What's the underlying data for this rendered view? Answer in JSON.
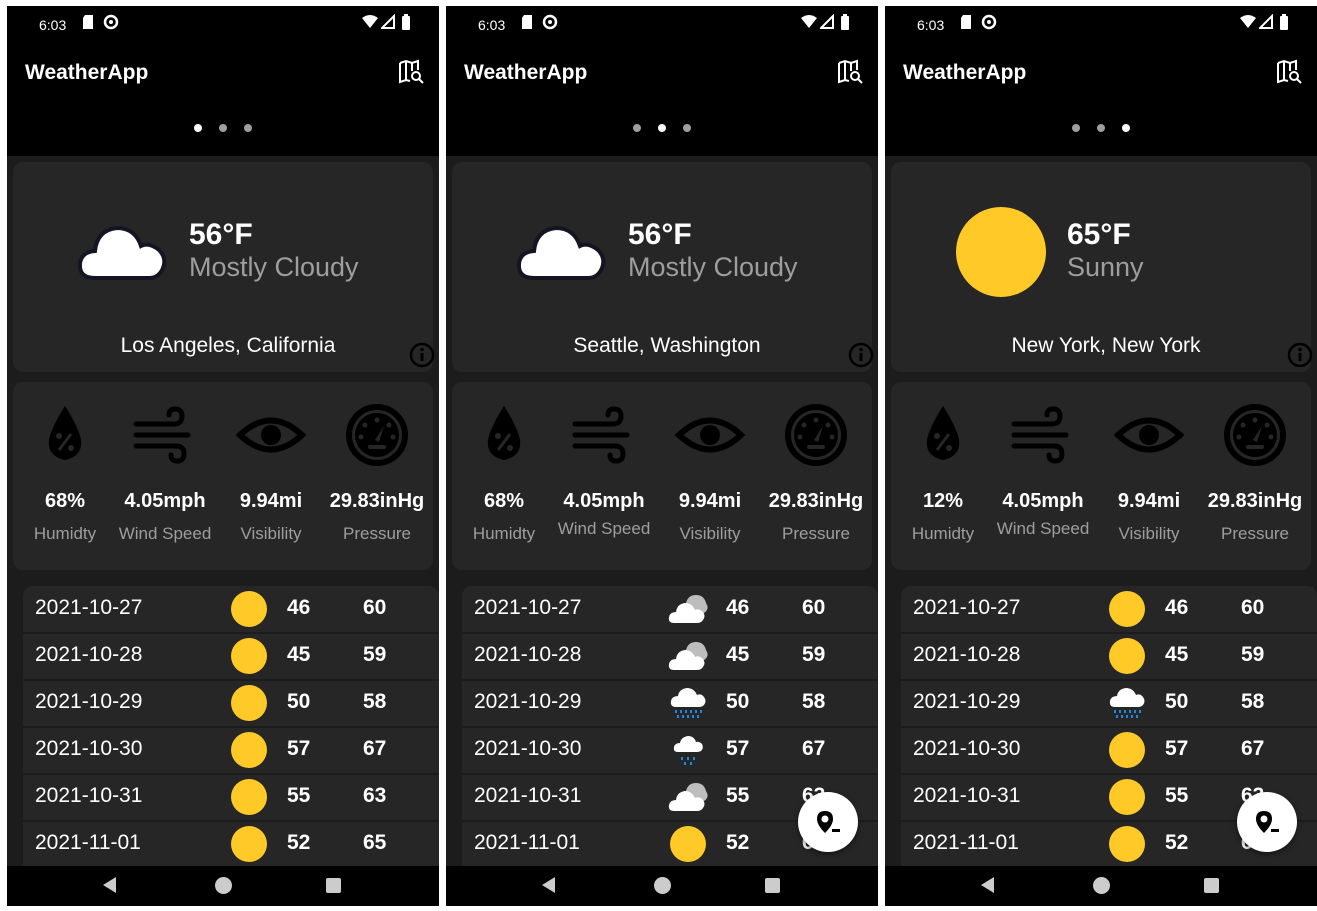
{
  "screens": [
    {
      "status": {
        "time": "6:03"
      },
      "app": {
        "title": "WeatherApp",
        "map_icon": "map-search-icon"
      },
      "pager": {
        "count": 3,
        "active": 0
      },
      "current": {
        "temp": "56°F",
        "condition": "Mostly Cloudy",
        "location": "Los Angeles, California",
        "icon": "cloud-icon"
      },
      "stats": [
        {
          "value": "68%",
          "label": "Humidty",
          "icon": "humidity-icon"
        },
        {
          "value": "4.05mph",
          "label": "Wind Speed",
          "icon": "wind-icon"
        },
        {
          "value": "9.94mi",
          "label": "Visibility",
          "icon": "eye-icon"
        },
        {
          "value": "29.83inHg",
          "label": "Pressure",
          "icon": "gauge-icon"
        }
      ],
      "forecast": [
        {
          "date": "2021-10-27",
          "icon": "sun-icon",
          "low": "46",
          "high": "60"
        },
        {
          "date": "2021-10-28",
          "icon": "sun-icon",
          "low": "45",
          "high": "59"
        },
        {
          "date": "2021-10-29",
          "icon": "sun-icon",
          "low": "50",
          "high": "58"
        },
        {
          "date": "2021-10-30",
          "icon": "sun-icon",
          "low": "57",
          "high": "67"
        },
        {
          "date": "2021-10-31",
          "icon": "sun-icon",
          "low": "55",
          "high": "63"
        },
        {
          "date": "2021-11-01",
          "icon": "sun-icon",
          "low": "52",
          "high": "65"
        }
      ],
      "fab": false
    },
    {
      "status": {
        "time": "6:03"
      },
      "app": {
        "title": "WeatherApp",
        "map_icon": "map-search-icon"
      },
      "pager": {
        "count": 3,
        "active": 1
      },
      "current": {
        "temp": "56°F",
        "condition": "Mostly Cloudy",
        "location": "Seattle, Washington",
        "icon": "cloud-icon"
      },
      "stats": [
        {
          "value": "68%",
          "label": "Humidty",
          "icon": "humidity-icon"
        },
        {
          "value": "4.05mph",
          "label": "Wind Speed",
          "icon": "wind-icon",
          "clipped": true
        },
        {
          "value": "9.94mi",
          "label": "Visibility",
          "icon": "eye-icon"
        },
        {
          "value": "29.83inHg",
          "label": "Pressure",
          "icon": "gauge-icon"
        }
      ],
      "forecast": [
        {
          "date": "2021-10-27",
          "icon": "partly-cloudy-icon",
          "low": "46",
          "high": "60"
        },
        {
          "date": "2021-10-28",
          "icon": "partly-cloudy-icon",
          "low": "45",
          "high": "59"
        },
        {
          "date": "2021-10-29",
          "icon": "rain-icon",
          "low": "50",
          "high": "58"
        },
        {
          "date": "2021-10-30",
          "icon": "light-rain-icon",
          "low": "57",
          "high": "67"
        },
        {
          "date": "2021-10-31",
          "icon": "partly-cloudy-icon",
          "low": "55",
          "high": "63"
        },
        {
          "date": "2021-11-01",
          "icon": "sun-icon",
          "low": "52",
          "high": "65"
        }
      ],
      "fab": true
    },
    {
      "status": {
        "time": "6:03"
      },
      "app": {
        "title": "WeatherApp",
        "map_icon": "map-search-icon"
      },
      "pager": {
        "count": 3,
        "active": 2
      },
      "current": {
        "temp": "65°F",
        "condition": "Sunny",
        "location": "New York, New York",
        "icon": "sun-icon"
      },
      "stats": [
        {
          "value": "12%",
          "label": "Humidty",
          "icon": "humidity-icon"
        },
        {
          "value": "4.05mph",
          "label": "Wind Speed",
          "icon": "wind-icon",
          "clipped": true
        },
        {
          "value": "9.94mi",
          "label": "Visibility",
          "icon": "eye-icon"
        },
        {
          "value": "29.83inHg",
          "label": "Pressure",
          "icon": "gauge-icon"
        }
      ],
      "forecast": [
        {
          "date": "2021-10-27",
          "icon": "sun-icon",
          "low": "46",
          "high": "60"
        },
        {
          "date": "2021-10-28",
          "icon": "sun-icon",
          "low": "45",
          "high": "59"
        },
        {
          "date": "2021-10-29",
          "icon": "rain-icon",
          "low": "50",
          "high": "58"
        },
        {
          "date": "2021-10-30",
          "icon": "sun-icon",
          "low": "57",
          "high": "67"
        },
        {
          "date": "2021-10-31",
          "icon": "sun-icon",
          "low": "55",
          "high": "63"
        },
        {
          "date": "2021-11-01",
          "icon": "sun-icon",
          "low": "52",
          "high": "65"
        }
      ],
      "fab": true
    }
  ],
  "colors": {
    "sun": "#ffca28",
    "background": "#1c1c1c",
    "card": "#262626",
    "secondary_text": "#9e9e9e",
    "rain": "#1e88e5"
  }
}
